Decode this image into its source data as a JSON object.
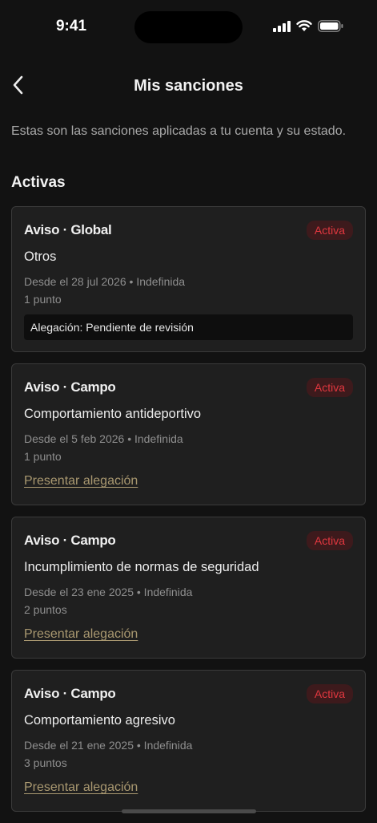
{
  "status_bar": {
    "time": "9:41",
    "icons": [
      "cellular-signal-icon",
      "wifi-icon",
      "battery-icon"
    ]
  },
  "nav": {
    "back_icon": "chevron-left-icon",
    "title": "Mis sanciones"
  },
  "intro": "Estas son las sanciones aplicadas a tu cuenta y su estado.",
  "section_title": "Activas",
  "colors": {
    "background": "#121212",
    "card": "#1F1F1F",
    "badge_text": "#E0373F",
    "badge_bg": "#3D1A1C",
    "link": "#A99870"
  },
  "sanctions": [
    {
      "kind": "Aviso · Global",
      "status": "Activa",
      "reason": "Otros",
      "since": "Desde el 28 jul 2026 • Indefinida",
      "points": "1 punto",
      "allegation": "Alegación: Pendiente de revisión"
    },
    {
      "kind": "Aviso · Campo",
      "status": "Activa",
      "reason": "Comportamiento antideportivo",
      "since": "Desde el 5 feb 2026 • Indefinida",
      "points": "1 punto",
      "action": "Presentar alegación"
    },
    {
      "kind": "Aviso · Campo",
      "status": "Activa",
      "reason": "Incumplimiento de normas de seguridad",
      "since": "Desde el 23 ene 2025 • Indefinida",
      "points": "2 puntos",
      "action": "Presentar alegación"
    },
    {
      "kind": "Aviso · Campo",
      "status": "Activa",
      "reason": "Comportamiento agresivo",
      "since": "Desde el 21 ene 2025 • Indefinida",
      "points": "3 puntos",
      "action": "Presentar alegación"
    }
  ]
}
